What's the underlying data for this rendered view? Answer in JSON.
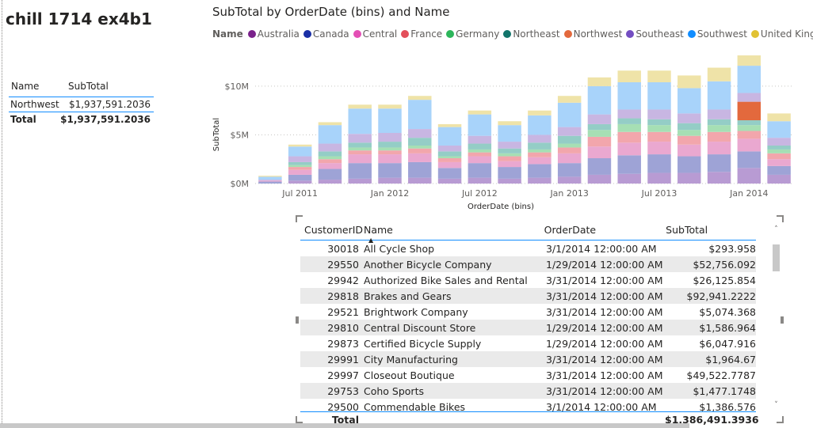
{
  "page": {
    "title": "chill 1714 ex4b1"
  },
  "summary_table": {
    "headers": [
      "Name",
      "SubTotal"
    ],
    "rows": [
      {
        "name": "Northwest",
        "subtotal": "$1,937,591.2036"
      }
    ],
    "total": {
      "label": "Total",
      "value": "$1,937,591.2036"
    }
  },
  "chart_data": {
    "type": "bar",
    "stacked": true,
    "title": "SubTotal by OrderDate (bins) and Name",
    "xlabel": "OrderDate (bins)",
    "ylabel": "SubTotal",
    "legend_title": "Name",
    "legend_position": "top",
    "y_ticks": [
      "$0M",
      "$5M",
      "$10M"
    ],
    "ylim": [
      0,
      13000000
    ],
    "x_ticks": [
      "Jul 2011",
      "Jan 2012",
      "Jul 2012",
      "Jan 2013",
      "Jul 2013",
      "Jan 2014"
    ],
    "grid": true,
    "categories": [
      "May 2011",
      "Jul 2011",
      "Sep 2011",
      "Nov 2011",
      "Jan 2012",
      "Mar 2012",
      "May 2012",
      "Jul 2012",
      "Sep 2012",
      "Nov 2012",
      "Jan 2013",
      "Mar 2013",
      "May 2013",
      "Jul 2013",
      "Sep 2013",
      "Nov 2013",
      "Jan 2014",
      "Mar 2014"
    ],
    "series": [
      {
        "name": "Australia",
        "color": "#b89bd3",
        "values": [
          0,
          0.3,
          0.4,
          0.5,
          0.6,
          0.6,
          0.5,
          0.6,
          0.5,
          0.6,
          0.7,
          0.9,
          1.0,
          1.1,
          1.1,
          1.2,
          1.6,
          0.9
        ]
      },
      {
        "name": "Canada",
        "color": "#9ea3d6",
        "values": [
          0.2,
          0.6,
          1.1,
          1.6,
          1.5,
          1.6,
          1.1,
          1.5,
          1.2,
          1.4,
          1.4,
          1.7,
          1.9,
          1.9,
          1.7,
          1.8,
          1.7,
          0.9
        ]
      },
      {
        "name": "Central",
        "color": "#eaa8d0",
        "values": [
          0.1,
          0.5,
          0.6,
          0.9,
          0.9,
          0.9,
          0.6,
          0.7,
          0.6,
          0.7,
          1.0,
          1.2,
          1.3,
          1.3,
          1.2,
          1.3,
          1.3,
          0.7
        ]
      },
      {
        "name": "France",
        "color": "#f2a6ac",
        "values": [
          0,
          0.3,
          0.4,
          0.4,
          0.4,
          0.5,
          0.4,
          0.4,
          0.5,
          0.5,
          0.6,
          1.0,
          1.1,
          1.0,
          0.9,
          1.0,
          0.8,
          0.6
        ]
      },
      {
        "name": "Germany",
        "color": "#a6dfb4",
        "values": [
          0,
          0.2,
          0.3,
          0.3,
          0.3,
          0.3,
          0.2,
          0.3,
          0.3,
          0.3,
          0.4,
          0.7,
          0.8,
          0.7,
          0.6,
          0.7,
          0.6,
          0.4
        ]
      },
      {
        "name": "Northeast",
        "color": "#94cdc6",
        "values": [
          0,
          0.3,
          0.5,
          0.5,
          0.6,
          0.8,
          0.5,
          0.6,
          0.5,
          0.7,
          0.8,
          0.6,
          0.6,
          0.6,
          0.7,
          0.6,
          0.5,
          0.4
        ]
      },
      {
        "name": "Northwest",
        "color": "#e3693d",
        "values": [
          0,
          0,
          0,
          0,
          0,
          0,
          0,
          0,
          0,
          0,
          0,
          0,
          0,
          0,
          0,
          0,
          1.9,
          0
        ]
      },
      {
        "name": "Southeast",
        "color": "#c8b6e2",
        "values": [
          0.1,
          0.6,
          0.8,
          0.9,
          0.9,
          0.9,
          0.6,
          0.8,
          0.7,
          0.8,
          0.9,
          1.0,
          0.9,
          1.0,
          1.0,
          1.0,
          0.9,
          0.8
        ]
      },
      {
        "name": "Southwest",
        "color": "#a8d3fa",
        "values": [
          0.3,
          1.0,
          1.9,
          2.6,
          2.5,
          3.0,
          1.9,
          2.2,
          1.7,
          2.0,
          2.5,
          2.9,
          2.8,
          2.8,
          2.6,
          2.9,
          2.8,
          1.7
        ]
      },
      {
        "name": "United Kingdom",
        "color": "#efe3a8",
        "values": [
          0.1,
          0.2,
          0.3,
          0.4,
          0.4,
          0.4,
          0.3,
          0.4,
          0.4,
          0.5,
          0.7,
          0.9,
          1.2,
          1.2,
          1.3,
          1.4,
          1.5,
          0.8
        ]
      }
    ],
    "legend_colors": [
      "#7a228b",
      "#1a2fa6",
      "#e44fb5",
      "#e34f5a",
      "#2db65b",
      "#12756b",
      "#e3693d",
      "#744ec2",
      "#118dff",
      "#e1c233"
    ]
  },
  "detail_table": {
    "headers": [
      "CustomerID",
      "Name",
      "OrderDate",
      "SubTotal"
    ],
    "sort_indicator": "▲",
    "rows": [
      [
        "30018",
        "All Cycle Shop",
        "3/1/2014 12:00:00 AM",
        "$293.958"
      ],
      [
        "29550",
        "Another Bicycle Company",
        "1/29/2014 12:00:00 AM",
        "$52,756.092"
      ],
      [
        "29942",
        "Authorized Bike Sales and Rental",
        "3/31/2014 12:00:00 AM",
        "$26,125.854"
      ],
      [
        "29818",
        "Brakes and Gears",
        "3/31/2014 12:00:00 AM",
        "$92,941.2222"
      ],
      [
        "29521",
        "Brightwork Company",
        "3/31/2014 12:00:00 AM",
        "$5,074.368"
      ],
      [
        "29810",
        "Central Discount Store",
        "1/29/2014 12:00:00 AM",
        "$1,586.964"
      ],
      [
        "29873",
        "Certified Bicycle Supply",
        "1/29/2014 12:00:00 AM",
        "$6,047.916"
      ],
      [
        "29991",
        "City Manufacturing",
        "3/31/2014 12:00:00 AM",
        "$1,964.67"
      ],
      [
        "29997",
        "Closeout Boutique",
        "3/31/2014 12:00:00 AM",
        "$49,522.7787"
      ],
      [
        "29753",
        "Coho Sports",
        "3/31/2014 12:00:00 AM",
        "$1,477.1748"
      ],
      [
        "29500",
        "Commendable Bikes",
        "3/1/2014 12:00:00 AM",
        "$1,386.576"
      ]
    ],
    "total": {
      "label": "Total",
      "value": "$1,386,491.3936"
    },
    "scroll": {
      "up": "˄",
      "down": "˅"
    }
  }
}
